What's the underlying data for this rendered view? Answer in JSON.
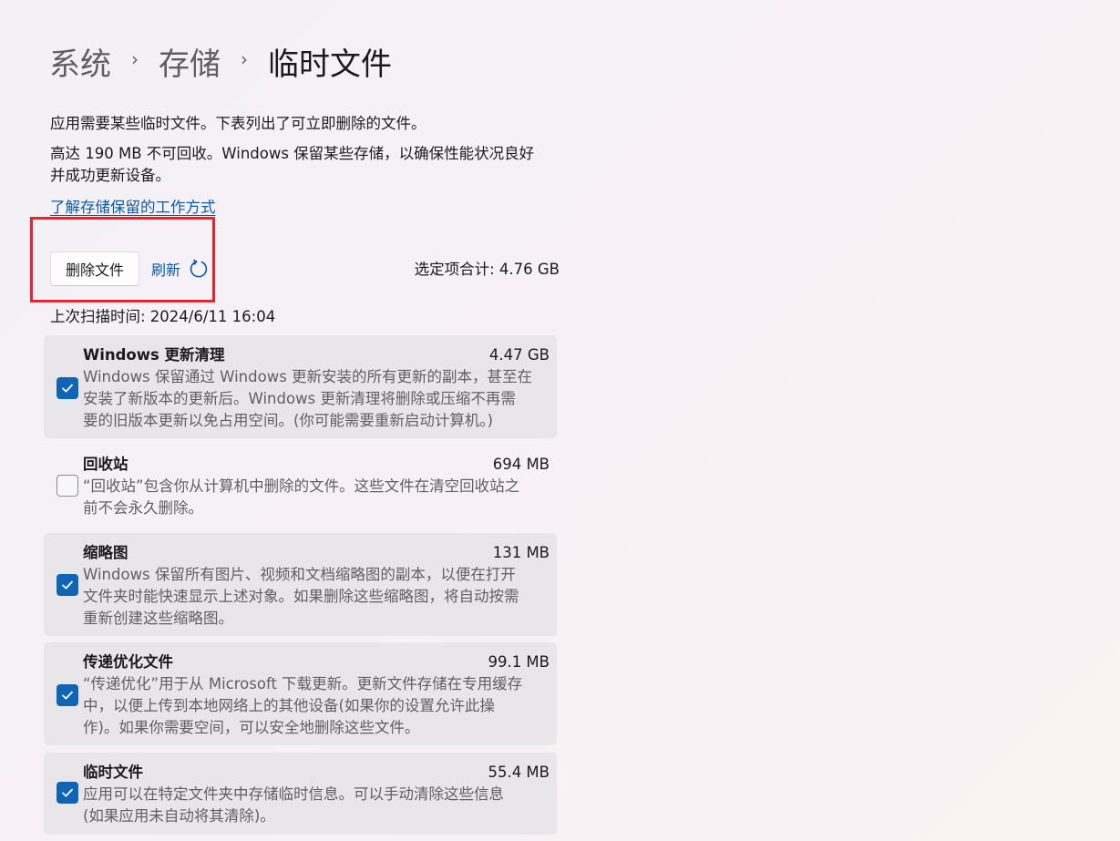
{
  "breadcrumb": {
    "items": [
      "系统",
      "存储"
    ],
    "current": "临时文件",
    "separator": "›"
  },
  "intro": {
    "line1": "应用需要某些临时文件。下表列出了可立即删除的文件。",
    "line2": "高达 190 MB 不可回收。Windows 保留某些存储，以确保性能状况良好",
    "line3": "并成功更新设备。",
    "link": "了解存储保留的工作方式"
  },
  "actions": {
    "delete_label": "删除文件",
    "refresh_label": "刷新",
    "selected_total": "选定项合计: 4.76 GB"
  },
  "scan_time": "上次扫描时间: 2024/6/11 16:04",
  "items": [
    {
      "title": "Windows 更新清理",
      "size": "4.47 GB",
      "checked": true,
      "desc": [
        "Windows 保留通过 Windows 更新安装的所有更新的副本，甚至在",
        "安装了新版本的更新后。Windows 更新清理将删除或压缩不再需",
        "要的旧版本更新以免占用空间。(你可能需要重新启动计算机。)"
      ]
    },
    {
      "title": "回收站",
      "size": "694 MB",
      "checked": false,
      "desc": [
        "“回收站”包含你从计算机中删除的文件。这些文件在清空回收站之",
        "前不会永久删除。"
      ]
    },
    {
      "title": "缩略图",
      "size": "131 MB",
      "checked": true,
      "desc": [
        "Windows 保留所有图片、视频和文档缩略图的副本，以便在打开",
        "文件夹时能快速显示上述对象。如果删除这些缩略图，将自动按需",
        "重新创建这些缩略图。"
      ]
    },
    {
      "title": "传递优化文件",
      "size": "99.1 MB",
      "checked": true,
      "desc": [
        "“传递优化”用于从 Microsoft 下载更新。更新文件存储在专用缓存",
        "中，以便上传到本地网络上的其他设备(如果你的设置允许此操",
        "作)。如果你需要空间，可以安全地删除这些文件。"
      ]
    },
    {
      "title": "临时文件",
      "size": "55.4 MB",
      "checked": true,
      "desc": [
        "应用可以在特定文件夹中存储临时信息。可以手动清除这些信息",
        "(如果应用未自动将其清除)。"
      ]
    }
  ],
  "colors": {
    "accent": "#0f64b5",
    "link": "#0a58a6",
    "highlight": "#e8242a"
  },
  "icons": {
    "refresh": "refresh-icon",
    "check": "checkmark-icon"
  }
}
